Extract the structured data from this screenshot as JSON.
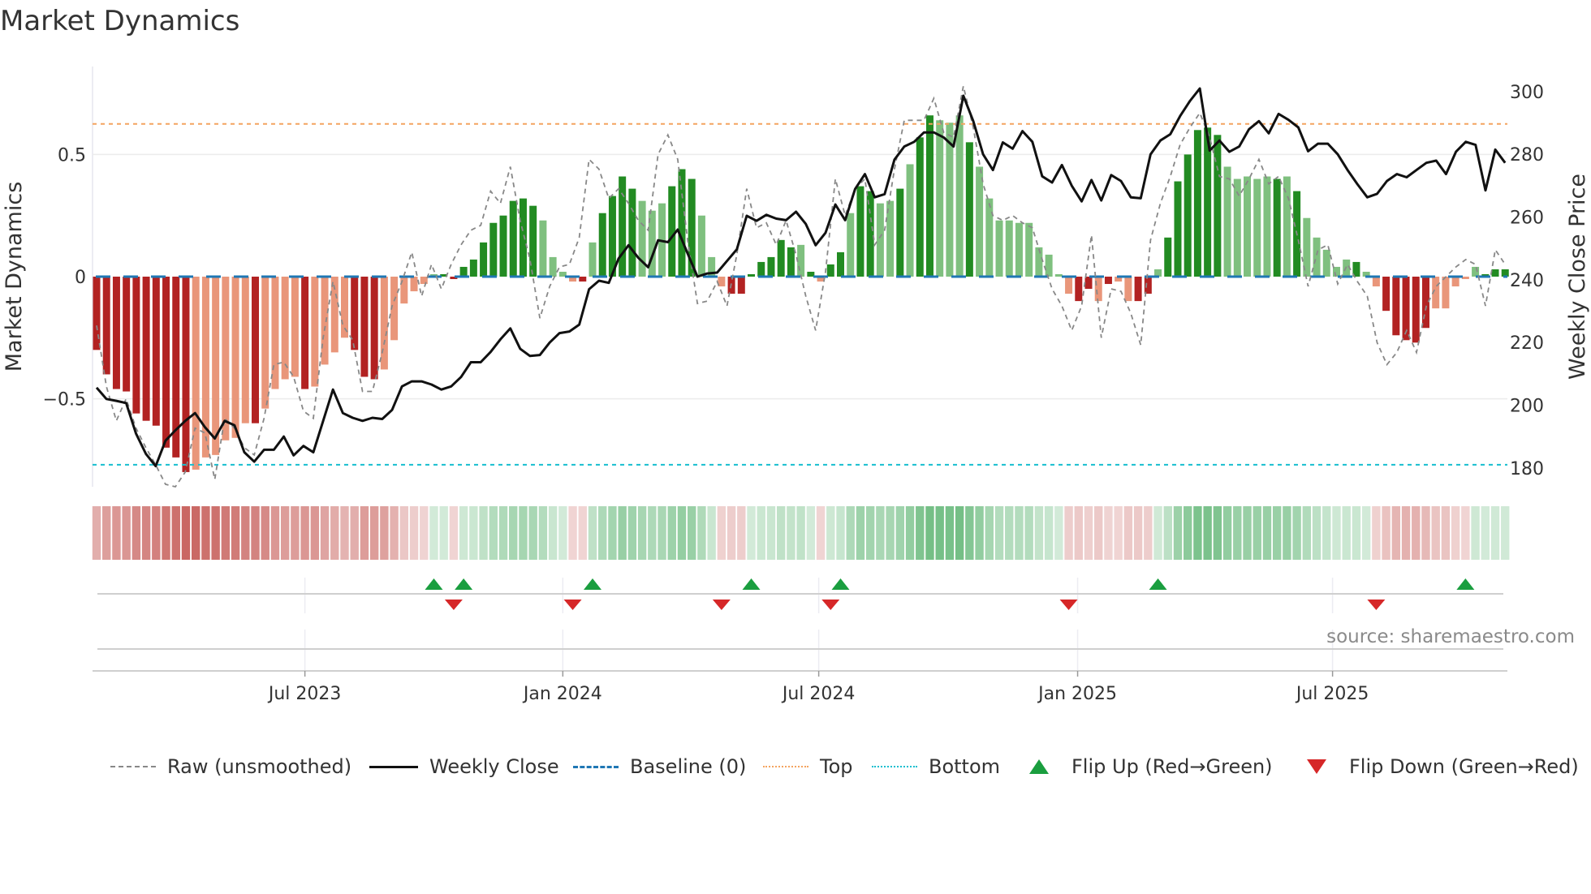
{
  "title": "Market Dynamics",
  "source": "source: sharemaestro.com",
  "chart_data": {
    "type": "bar",
    "title": "Market Dynamics",
    "ylabel": "Market Dynamics",
    "y2label": "Weekly Close Price",
    "ylim": [
      -0.86,
      0.86
    ],
    "y2lim": [
      174,
      308
    ],
    "yticks": [
      {
        "v": 0.5,
        "label": "0.5"
      },
      {
        "v": 0,
        "label": "0"
      },
      {
        "v": -0.5,
        "label": "−0.5"
      }
    ],
    "y2ticks": [
      {
        "v": 300,
        "label": "300"
      },
      {
        "v": 280,
        "label": "280"
      },
      {
        "v": 260,
        "label": "260"
      },
      {
        "v": 240,
        "label": "240"
      },
      {
        "v": 220,
        "label": "220"
      },
      {
        "v": 200,
        "label": "200"
      },
      {
        "v": 180,
        "label": "180"
      }
    ],
    "xticks": [
      {
        "week": 21.0,
        "label": "Jul 2023"
      },
      {
        "week": 47.0,
        "label": "Jan 2024"
      },
      {
        "week": 72.8,
        "label": "Jul 2024"
      },
      {
        "week": 98.9,
        "label": "Jan 2025"
      },
      {
        "week": 124.6,
        "label": "Jul 2025"
      }
    ],
    "top_level": 0.625,
    "bottom_level": -0.77,
    "baseline": 0,
    "colors": {
      "strong_up": "#228b22",
      "weak_up": "#7fc07f",
      "strong_down": "#b22222",
      "weak_down": "#e9967a",
      "close": "#111111",
      "raw": "#888888",
      "baseline": "#1f77b4",
      "top": "#f4a460",
      "bottom": "#17becf",
      "flip_up": "#1a9e3f",
      "flip_down": "#d62728"
    },
    "dynamics": [
      -0.3,
      -0.4,
      -0.46,
      -0.47,
      -0.56,
      -0.59,
      -0.61,
      -0.7,
      -0.74,
      -0.8,
      -0.79,
      -0.74,
      -0.73,
      -0.67,
      -0.66,
      -0.6,
      -0.6,
      -0.54,
      -0.46,
      -0.42,
      -0.41,
      -0.46,
      -0.45,
      -0.36,
      -0.31,
      -0.25,
      -0.3,
      -0.41,
      -0.42,
      -0.38,
      -0.26,
      -0.11,
      -0.06,
      -0.03,
      0.01,
      0.01,
      -0.01,
      0.04,
      0.07,
      0.14,
      0.22,
      0.25,
      0.31,
      0.32,
      0.29,
      0.23,
      0.08,
      0.02,
      -0.02,
      -0.02,
      0.14,
      0.26,
      0.33,
      0.41,
      0.36,
      0.31,
      0.27,
      0.3,
      0.37,
      0.44,
      0.4,
      0.25,
      0.08,
      -0.04,
      -0.07,
      -0.07,
      0.01,
      0.06,
      0.08,
      0.15,
      0.12,
      0.13,
      0.02,
      -0.02,
      0.05,
      0.1,
      0.26,
      0.37,
      0.35,
      0.3,
      0.31,
      0.36,
      0.46,
      0.57,
      0.66,
      0.64,
      0.63,
      0.66,
      0.55,
      0.45,
      0.32,
      0.23,
      0.23,
      0.22,
      0.22,
      0.12,
      0.09,
      0.01,
      -0.07,
      -0.1,
      -0.05,
      -0.1,
      -0.03,
      -0.02,
      -0.1,
      -0.1,
      -0.07,
      0.03,
      0.16,
      0.39,
      0.5,
      0.6,
      0.61,
      0.58,
      0.45,
      0.4,
      0.41,
      0.4,
      0.41,
      0.4,
      0.41,
      0.35,
      0.24,
      0.16,
      0.11,
      0.04,
      0.07,
      0.06,
      0.02,
      -0.04,
      -0.14,
      -0.24,
      -0.26,
      -0.27,
      -0.21,
      -0.13,
      -0.13,
      -0.04,
      -0.01,
      0.04,
      0.01,
      0.03,
      0.03
    ],
    "strength": "SSSSSSSSSSWWWWWWSWWWWSWWWWSSSWWWWWWSSSSSSSSSSWWWWSWSSSSWWWSSSWWWSSSSSSSWSWSSWSSWWSWSSWWWSWWWWWWWWWWSSWSWWSSWSSSSSSWWWWWSWSWWWWWSWWSSSSSWWWWWSSSW",
    "weekly_close": [
      205.6,
      202,
      201.4,
      200.7,
      191,
      184.5,
      180.6,
      188.7,
      192,
      195,
      197.5,
      193,
      189.4,
      195,
      193.6,
      185,
      182,
      185.8,
      185.8,
      190,
      184,
      187,
      185,
      195,
      205,
      197.5,
      196,
      195,
      196,
      195.6,
      198.5,
      206,
      207.6,
      207.6,
      206.6,
      205,
      206,
      209,
      213.7,
      213.7,
      217,
      221,
      224.5,
      218,
      215.7,
      216,
      220,
      223,
      223.5,
      225.7,
      237,
      239.7,
      239,
      246.8,
      251,
      247,
      244,
      252.6,
      252,
      256,
      248.4,
      241,
      242,
      242.3,
      246,
      249.7,
      260.4,
      258.8,
      260.7,
      259.5,
      259,
      261.7,
      257.8,
      251,
      255,
      264,
      259,
      268.9,
      273.7,
      266.3,
      267.3,
      278.3,
      282.5,
      284,
      287,
      287,
      285.4,
      282.5,
      298.7,
      290.6,
      280,
      275,
      283.8,
      281.8,
      287.4,
      284,
      273,
      271,
      276.6,
      270,
      265,
      271.8,
      265.3,
      273.4,
      271.5,
      266.3,
      266,
      280,
      284.4,
      286.4,
      292.2,
      297,
      301,
      281.2,
      284.4,
      280.8,
      282.5,
      288,
      290.6,
      286.7,
      292.9,
      291,
      288.6,
      281,
      283.4,
      283.4,
      280,
      275,
      270.5,
      266.3,
      267.4,
      271.5,
      273.7,
      272.7,
      275,
      277.3,
      278,
      273.7,
      280.8,
      284,
      283,
      268.5,
      281.5,
      277.3
    ],
    "raw": [
      -0.2,
      -0.45,
      -0.59,
      -0.5,
      -0.62,
      -0.7,
      -0.77,
      -0.85,
      -0.86,
      -0.8,
      -0.62,
      -0.64,
      -0.83,
      -0.58,
      -0.62,
      -0.7,
      -0.73,
      -0.58,
      -0.36,
      -0.35,
      -0.41,
      -0.55,
      -0.58,
      -0.25,
      -0.02,
      -0.2,
      -0.26,
      -0.47,
      -0.47,
      -0.31,
      -0.12,
      -0.02,
      0.1,
      -0.08,
      0.05,
      -0.05,
      0.05,
      0.13,
      0.19,
      0.21,
      0.35,
      0.3,
      0.45,
      0.23,
      0.07,
      -0.17,
      -0.04,
      0.04,
      0.05,
      0.16,
      0.48,
      0.44,
      0.32,
      0.36,
      0.3,
      0.23,
      0.19,
      0.5,
      0.58,
      0.48,
      0.15,
      -0.11,
      -0.1,
      -0.02,
      -0.12,
      0.09,
      0.36,
      0.2,
      0.22,
      0.13,
      0.23,
      0.09,
      -0.08,
      -0.22,
      0.02,
      0.4,
      0.25,
      0.36,
      0.4,
      0.13,
      0.19,
      0.44,
      0.64,
      0.64,
      0.64,
      0.73,
      0.59,
      0.57,
      0.78,
      0.61,
      0.38,
      0.25,
      0.23,
      0.25,
      0.22,
      0.2,
      0.07,
      -0.05,
      -0.12,
      -0.22,
      -0.12,
      0.17,
      -0.25,
      -0.05,
      -0.06,
      -0.15,
      -0.28,
      0.15,
      0.3,
      0.41,
      0.54,
      0.61,
      0.67,
      0.57,
      0.41,
      0.4,
      0.33,
      0.4,
      0.48,
      0.38,
      0.41,
      0.32,
      0.15,
      -0.04,
      0.11,
      0.13,
      -0.03,
      0.05,
      -0.02,
      -0.08,
      -0.27,
      -0.36,
      -0.31,
      -0.22,
      -0.31,
      -0.12,
      -0.04,
      0.0,
      0.04,
      0.07,
      0.05,
      -0.12,
      0.11,
      0.05
    ],
    "flip_up_weeks": [
      34,
      37,
      50,
      66,
      75,
      107,
      138
    ],
    "flip_down_weeks": [
      36,
      48,
      63,
      74,
      98,
      129
    ],
    "legend": {
      "position": "bottom",
      "items": [
        {
          "label": "Raw (unsmoothed)",
          "kind": "raw"
        },
        {
          "label": "Weekly Close",
          "kind": "close"
        },
        {
          "label": "Baseline (0)",
          "kind": "baseline"
        },
        {
          "label": "Top",
          "kind": "top"
        },
        {
          "label": "Bottom",
          "kind": "bottom"
        },
        {
          "label": "Flip Up (Red→Green)",
          "kind": "flip_up"
        },
        {
          "label": "Flip Down (Green→Red)",
          "kind": "flip_down"
        }
      ]
    }
  }
}
